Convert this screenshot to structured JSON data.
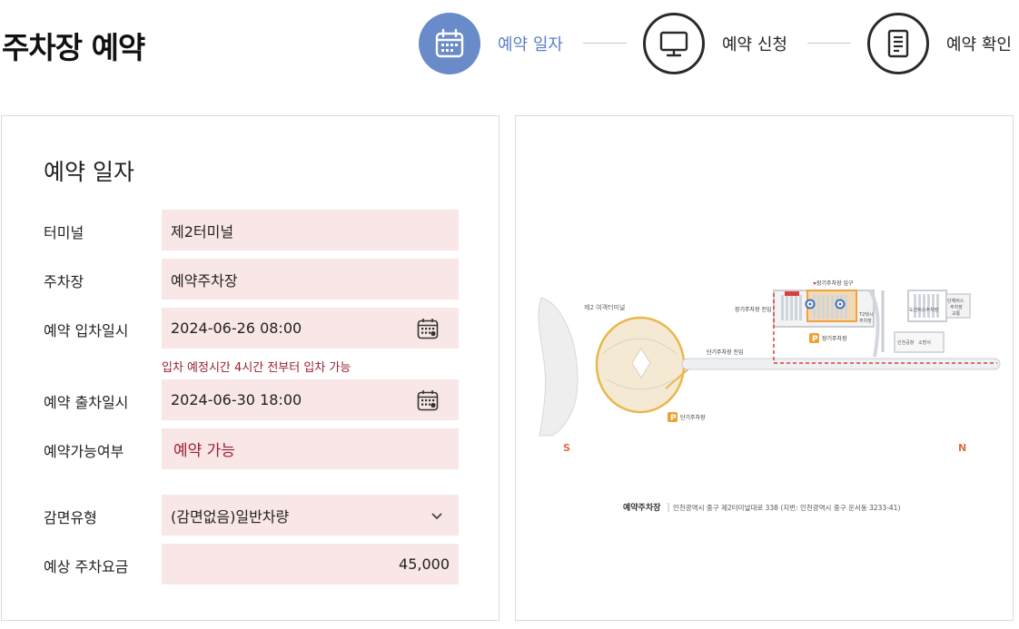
{
  "page": {
    "title": "주차장 예약"
  },
  "steps": [
    {
      "label": "예약 일자",
      "state": "active",
      "icon": "calendar-icon"
    },
    {
      "label": "예약 신청",
      "state": "idle",
      "icon": "monitor-icon"
    },
    {
      "label": "예약 확인",
      "state": "idle",
      "icon": "document-icon"
    }
  ],
  "colors": {
    "accent": "#6a8bc9",
    "field_bg": "#f9e6e6",
    "warning_text": "#9a1f35"
  },
  "form": {
    "heading": "예약 일자",
    "terminal": {
      "label": "터미널",
      "value": "제2터미널"
    },
    "parking": {
      "label": "주차장",
      "value": "예약주차장"
    },
    "entry": {
      "label": "예약 입차일시",
      "value": "2024-06-26 08:00",
      "icon": "calendar-icon"
    },
    "entry_hint": "입차 예정시간 4시간 전부터 입차 가능",
    "exit": {
      "label": "예약 출차일시",
      "value": "2024-06-30 18:00",
      "icon": "calendar-icon"
    },
    "availability": {
      "label": "예약가능여부",
      "value": "예약 가능"
    },
    "discount": {
      "label": "감면유형",
      "value": "(감면없음)일반차량",
      "icon": "chevron-down-icon"
    },
    "fee": {
      "label": "예상 주차요금",
      "value": "45,000"
    }
  },
  "map": {
    "terminal_label": "제2 여객터미널",
    "long_term_entrance": "장기주차장 입구",
    "long_term_entry_road": "장기주차장 진입",
    "long_term_lot": "장기주차장",
    "short_term_entry_road": "단기주차장 진입",
    "short_term_lot": "단기주차장",
    "lot_a": "예약주차장",
    "lot_b_line1": "도선버스주차장",
    "lot_c_line1": "인천공항",
    "lot_c_line2": "소방서",
    "lot_d_line1": "단체버스",
    "lot_d_line2": "주차장",
    "lot_d_line3": "교통",
    "lot_e_line1": "T2택시",
    "lot_e_line2": "주차장",
    "compass_s": "S",
    "compass_n": "N",
    "caption_title": "예약주차장",
    "caption_address": "인천광역시 중구 제2터미널대로 338 (지번: 인천광역시 중구 운서동 3233-41)"
  }
}
